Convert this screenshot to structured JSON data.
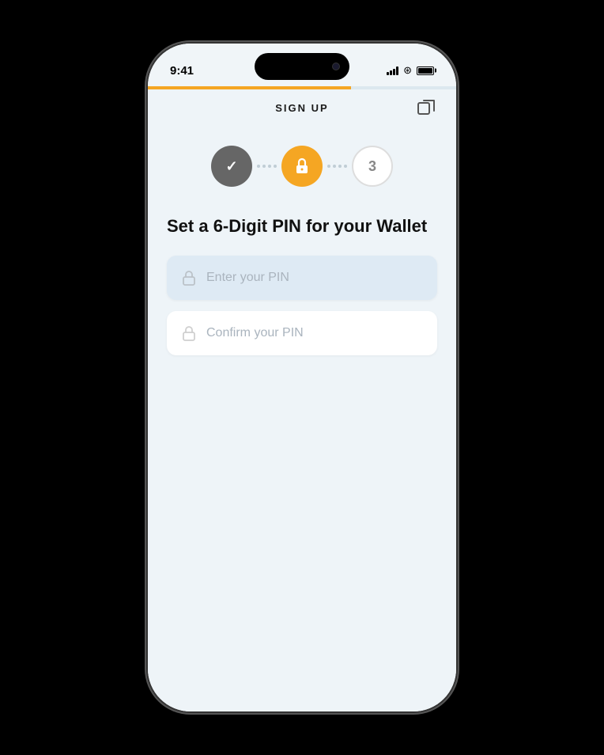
{
  "app": {
    "title": "SIGN UP"
  },
  "statusBar": {
    "time": "9:41"
  },
  "progressBar": {
    "fillPercent": 66
  },
  "steps": [
    {
      "id": 1,
      "state": "completed",
      "label": "✓"
    },
    {
      "id": 2,
      "state": "active",
      "label": "lock"
    },
    {
      "id": 3,
      "state": "pending",
      "label": "3"
    }
  ],
  "content": {
    "title": "Set a 6-Digit PIN for your Wallet",
    "enterPinPlaceholder": "Enter your PIN",
    "confirmPinPlaceholder": "Confirm your PIN"
  }
}
